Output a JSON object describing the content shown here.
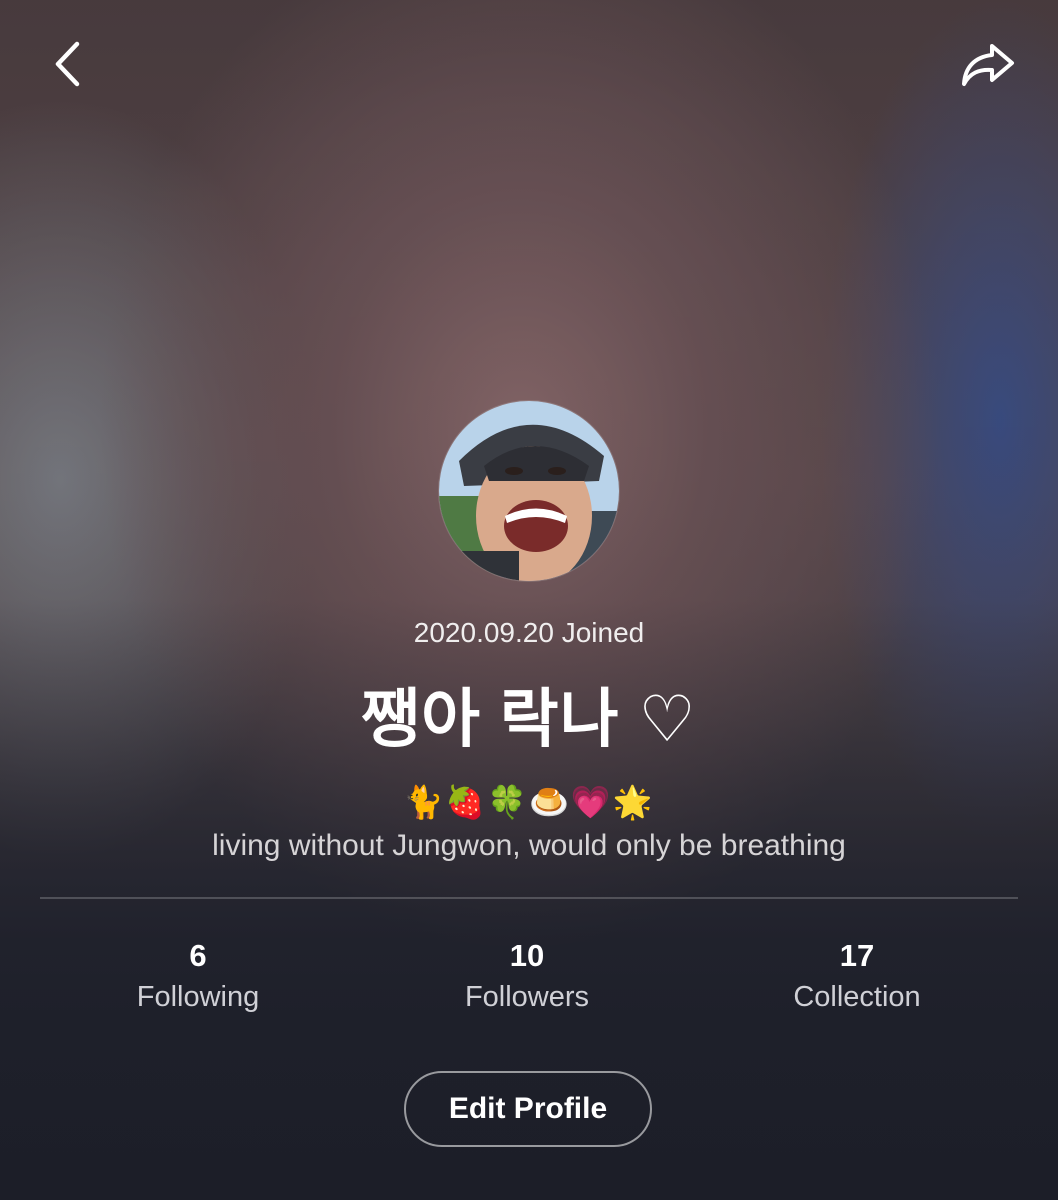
{
  "header": {
    "back_icon": "chevron-left-icon",
    "share_icon": "share-arrow-icon"
  },
  "profile": {
    "joined": "2020.09.20 Joined",
    "name": "쨍아 락나 ♡",
    "emojis": "🐈🍓🍀🍮💗🌟",
    "bio": "living without Jungwon, would only be breathing"
  },
  "stats": [
    {
      "count": "6",
      "label": "Following"
    },
    {
      "count": "10",
      "label": "Followers"
    },
    {
      "count": "17",
      "label": "Collection"
    }
  ],
  "actions": {
    "edit_profile_label": "Edit Profile"
  },
  "colors": {
    "text_primary": "#ffffff",
    "text_secondary": "#d0d0d6",
    "background_bottom": "#22242e"
  }
}
